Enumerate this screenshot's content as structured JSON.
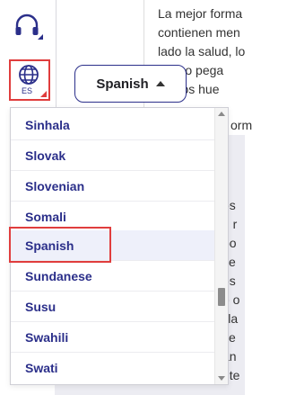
{
  "rail": {
    "headphones_icon": "headphones-icon",
    "language_icon": "globe-icon",
    "language_code": "ES",
    "accent_color": "#2b2f8a",
    "highlight_color": "#e03d3d"
  },
  "article": {
    "lines": [
      "La mejor forma",
      "contienen men",
      "lado la salud, lo",
      "es, no pega",
      "car los hue",
      "orm"
    ],
    "fragments": [
      "os",
      "n r",
      "po",
      "se",
      "os",
      "e o",
      "illa",
      "se",
      "an",
      "nte"
    ]
  },
  "language_selector": {
    "label": "Spanish"
  },
  "dropdown": {
    "items": [
      "Sinhala",
      "Slovak",
      "Slovenian",
      "Somali",
      "Spanish",
      "Sundanese",
      "Susu",
      "Swahili",
      "Swati"
    ],
    "selected": "Spanish"
  }
}
